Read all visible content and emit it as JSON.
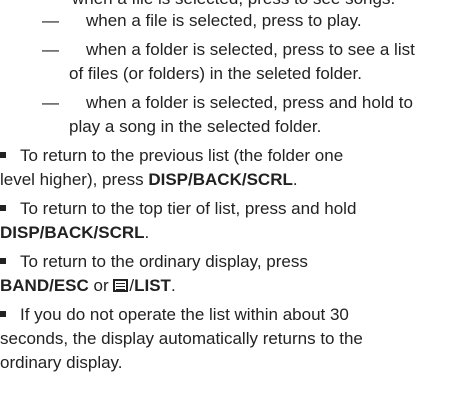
{
  "line0": "when a file is selected, press to play.",
  "line_partial": "when a file is selected, press to see songs.",
  "item2_line1": "when a folder is selected, press to see a list",
  "item2_line2": "of files (or folders) in the seleted folder.",
  "item3_line1": "when a folder is selected, press and hold to",
  "item3_line2": "play a song in the selected folder.",
  "dash": "—",
  "b1_line1": "To return to the previous list (the folder one",
  "b1_line2_pre": "level higher), press ",
  "b1_key": "DISP/BACK/SCRL",
  "b1_end": ".",
  "b2_line1": "To return to the top tier of list, press and hold",
  "b2_key": "DISP/BACK/SCRL",
  "b2_end": ".",
  "b3_line1": "To return to the ordinary display, press",
  "b3_key1": "BAND/ESC",
  "b3_or": " or ",
  "b3_slash": "/",
  "b3_key2": "LIST",
  "b3_end": ".",
  "b4_line1": "If you do not operate the list within about 30",
  "b4_line2": "seconds, the display automatically returns to the",
  "b4_line3": "ordinary display.",
  "list_icon": "list-icon"
}
